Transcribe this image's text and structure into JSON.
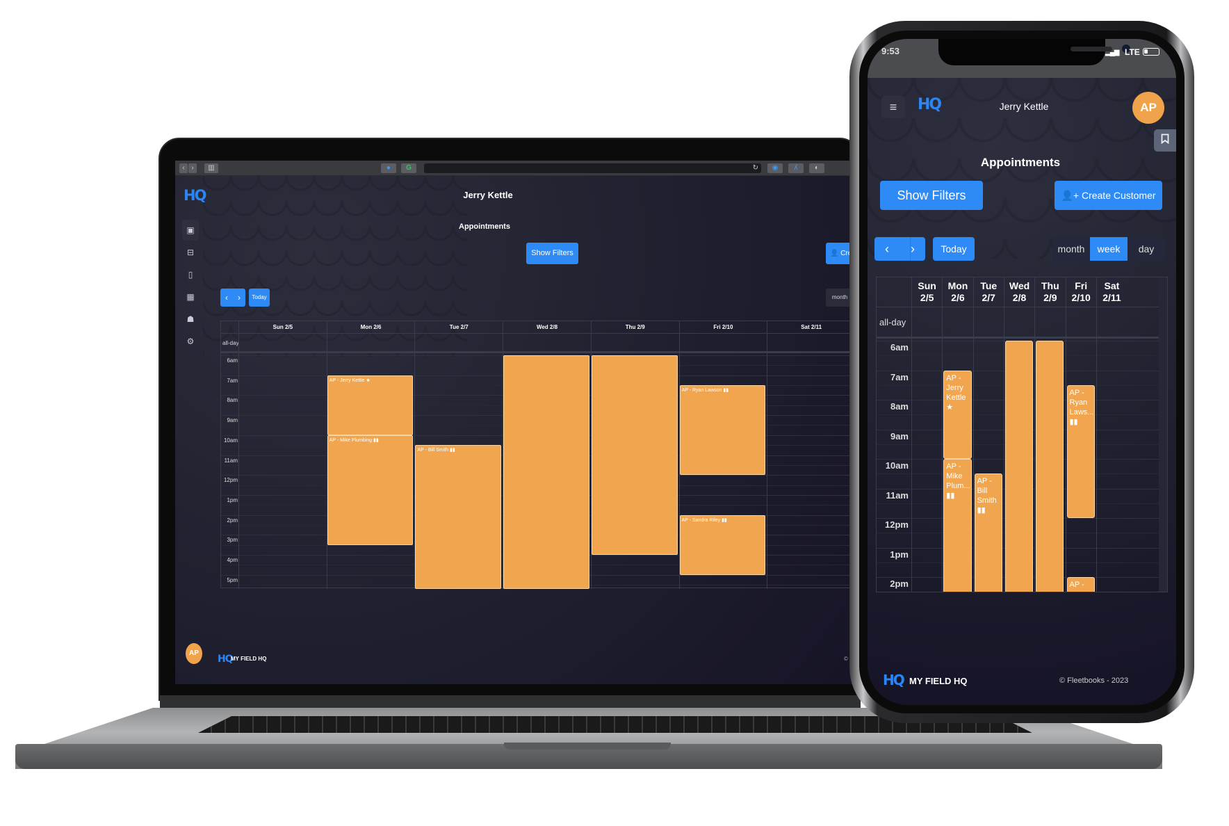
{
  "laptop": {
    "browser": {
      "back_icon": "‹",
      "forward_icon": "›",
      "sidebar_icon": "▥",
      "ext1_icon": "●",
      "ext2_icon": "G",
      "reload_icon": "↻",
      "ext3_icon": "◉",
      "ext4_icon": "ʎ",
      "ext5_icon": "◐"
    },
    "app": {
      "logo": "HQ",
      "sidebar": [
        {
          "icon": "calendar-icon",
          "glyph": "▣",
          "active": true
        },
        {
          "icon": "briefcase-icon",
          "glyph": "⊟"
        },
        {
          "icon": "invoice-icon",
          "glyph": "▯"
        },
        {
          "icon": "warehouse-icon",
          "glyph": "▦"
        },
        {
          "icon": "users-icon",
          "glyph": "☗"
        },
        {
          "icon": "settings-icon",
          "glyph": "⚙"
        }
      ],
      "user_name": "Jerry Kettle",
      "page_title": "Appointments",
      "show_filters_label": "Show Filters",
      "create_customer_label": "Crea",
      "create_customer_icon": "👤",
      "prev_icon": "‹",
      "next_icon": "›",
      "today_label": "Today",
      "view_month_label": "month",
      "avatar_initials": "AP",
      "footer_logo": "HQ",
      "footer_brand": "MY FIELD HQ",
      "footer_copy": "© F"
    },
    "calendar": {
      "days": [
        "Sun 2/5",
        "Mon 2/6",
        "Tue 2/7",
        "Wed 2/8",
        "Thu 2/9",
        "Fri 2/10",
        "Sat 2/11"
      ],
      "all_day_label": "all-day",
      "times": [
        "6am",
        "7am",
        "8am",
        "9am",
        "10am",
        "11am",
        "12pm",
        "1pm",
        "2pm",
        "3pm",
        "4pm",
        "5pm"
      ],
      "events": [
        {
          "day": 1,
          "start": 7.0,
          "end": 10.0,
          "title": "AP - Jerry Kettle ★"
        },
        {
          "day": 1,
          "start": 10.0,
          "end": 15.5,
          "title": "AP - Mike Plumbing ▮▮"
        },
        {
          "day": 2,
          "start": 10.5,
          "end": 18.0,
          "title": "AP - Bill Smith ▮▮"
        },
        {
          "day": 3,
          "start": 6.0,
          "end": 18.0,
          "title": ""
        },
        {
          "day": 4,
          "start": 6.0,
          "end": 16.0,
          "title": ""
        },
        {
          "day": 5,
          "start": 7.5,
          "end": 12.0,
          "title": "AP - Ryan Lawson ▮▮"
        },
        {
          "day": 5,
          "start": 14.0,
          "end": 17.0,
          "title": "AP - Sandra Riley ▮▮"
        }
      ]
    }
  },
  "phone": {
    "status": {
      "time": "9:53",
      "signal": "▂▄▆",
      "network": "LTE"
    },
    "app": {
      "menu_icon": "≡",
      "logo": "HQ",
      "user_name": "Jerry Kettle",
      "avatar_initials": "AP",
      "bookmark_icon": "🔖",
      "page_title": "Appointments",
      "show_filters_label": "Show Filters",
      "create_customer_label": "Create Customer",
      "create_customer_icon": "👤+",
      "prev_icon": "‹",
      "next_icon": "›",
      "today_label": "Today",
      "views": [
        {
          "label": "month",
          "active": false
        },
        {
          "label": "week",
          "active": true
        },
        {
          "label": "day",
          "active": false
        }
      ],
      "footer_logo": "HQ",
      "footer_brand": "MY FIELD HQ",
      "footer_copy": "© Fleetbooks - 2023"
    },
    "calendar": {
      "days": [
        {
          "dow": "Sun",
          "date": "2/5"
        },
        {
          "dow": "Mon",
          "date": "2/6"
        },
        {
          "dow": "Tue",
          "date": "2/7"
        },
        {
          "dow": "Wed",
          "date": "2/8"
        },
        {
          "dow": "Thu",
          "date": "2/9"
        },
        {
          "dow": "Fri",
          "date": "2/10"
        },
        {
          "dow": "Sat",
          "date": "2/11"
        }
      ],
      "all_day_label": "all-day",
      "times": [
        "6am",
        "7am",
        "8am",
        "9am",
        "10am",
        "11am",
        "12pm",
        "1pm",
        "2pm"
      ],
      "events": [
        {
          "day": 1,
          "start": 7.0,
          "end": 10.0,
          "lines": [
            "AP -",
            "Jerry",
            "Kettle",
            "★"
          ]
        },
        {
          "day": 1,
          "start": 10.0,
          "end": 15.5,
          "lines": [
            "AP -",
            "Mike",
            "Plum...",
            "▮▮"
          ]
        },
        {
          "day": 2,
          "start": 10.5,
          "end": 18.0,
          "lines": [
            "AP -",
            "Bill",
            "Smith",
            "▮▮"
          ]
        },
        {
          "day": 3,
          "start": 6.0,
          "end": 18.0,
          "lines": []
        },
        {
          "day": 4,
          "start": 6.0,
          "end": 16.0,
          "lines": []
        },
        {
          "day": 5,
          "start": 7.5,
          "end": 12.0,
          "lines": [
            "AP -",
            "Ryan",
            "Laws...",
            "▮▮"
          ]
        },
        {
          "day": 5,
          "start": 14.0,
          "end": 17.0,
          "lines": [
            "AP -"
          ]
        }
      ]
    }
  },
  "colors": {
    "accent": "#2e8bf6",
    "event": "#f0a54e",
    "avatar": "#f0a34b",
    "background": "#1f2130"
  }
}
